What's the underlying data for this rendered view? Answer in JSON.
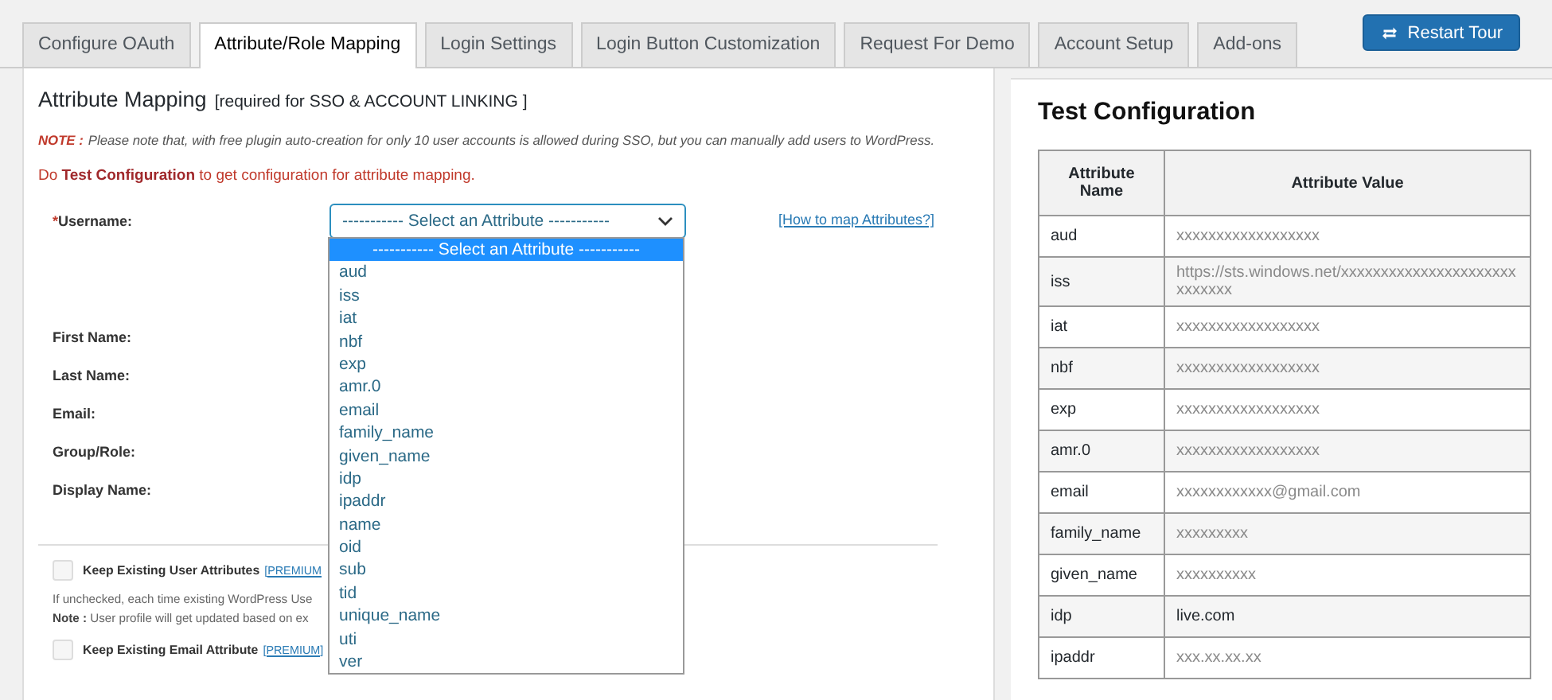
{
  "tabs": [
    {
      "label": "Configure OAuth",
      "selected": false
    },
    {
      "label": "Attribute/Role Mapping",
      "selected": true
    },
    {
      "label": "Login Settings",
      "selected": false
    },
    {
      "label": "Login Button Customization",
      "selected": false
    },
    {
      "label": "Request For Demo",
      "selected": false
    },
    {
      "label": "Account Setup",
      "selected": false
    },
    {
      "label": "Add-ons",
      "selected": false
    }
  ],
  "restart_button": {
    "label": "Restart Tour"
  },
  "attribute_mapping": {
    "title": "Attribute Mapping",
    "subtitle": "[required for SSO & ACCOUNT LINKING ]",
    "note_label": "NOTE :",
    "note_text": "Please note that, with free plugin auto-creation for only 10 user accounts is allowed during SSO, but you can manually add users to WordPress.",
    "hint": "Do **Test Configuration** to get configuration for attribute mapping.",
    "fields": [
      {
        "label": "Username:",
        "required_mark": "*"
      },
      {
        "label": "First Name:"
      },
      {
        "label": "Last Name:"
      },
      {
        "label": "Email:"
      },
      {
        "label": "Group/Role:"
      },
      {
        "label": "Display Name:"
      }
    ],
    "select": {
      "value": "----------- Select an Attribute -----------",
      "expanded": true,
      "options": [
        {
          "label": "----------- Select an Attribute -----------",
          "selected": true
        },
        {
          "label": "aud",
          "selected": false
        },
        {
          "label": "iss",
          "selected": false
        },
        {
          "label": "iat",
          "selected": false
        },
        {
          "label": "nbf",
          "selected": false
        },
        {
          "label": "exp",
          "selected": false
        },
        {
          "label": "amr.0",
          "selected": false
        },
        {
          "label": "email",
          "selected": false
        },
        {
          "label": "family_name",
          "selected": false
        },
        {
          "label": "given_name",
          "selected": false
        },
        {
          "label": "idp",
          "selected": false
        },
        {
          "label": "ipaddr",
          "selected": false
        },
        {
          "label": "name",
          "selected": false
        },
        {
          "label": "oid",
          "selected": false
        },
        {
          "label": "sub",
          "selected": false
        },
        {
          "label": "tid",
          "selected": false
        },
        {
          "label": "unique_name",
          "selected": false
        },
        {
          "label": "uti",
          "selected": false
        },
        {
          "label": "ver",
          "selected": false
        }
      ]
    },
    "help_link": "[How to map Attributes?]",
    "options": [
      {
        "kind": "checkbox",
        "label": "Keep Existing User Attributes",
        "badge": "[PREMIUM",
        "checked": false
      },
      {
        "kind": "text",
        "text": "If unchecked, each time existing WordPress Use"
      },
      {
        "kind": "text",
        "text": "**Note :** User profile will get updated based on ex"
      },
      {
        "kind": "checkbox",
        "label": "Keep Existing Email Attribute",
        "badge": "[PREMIUM]",
        "checked": false
      }
    ]
  },
  "test_configuration": {
    "title": "Test Configuration",
    "columns": [
      "Attribute Name",
      "Attribute Value"
    ],
    "rows": [
      {
        "name": "aud",
        "value": "xxxxxxxxxxxxxxxxxx",
        "masked": true
      },
      {
        "name": "iss",
        "value": "https://sts.windows.net/xxxxxxxxxxxxxxxxxxxxxxxxxxxxx",
        "masked": true
      },
      {
        "name": "iat",
        "value": "xxxxxxxxxxxxxxxxxx",
        "masked": true
      },
      {
        "name": "nbf",
        "value": "xxxxxxxxxxxxxxxxxx",
        "masked": true
      },
      {
        "name": "exp",
        "value": "xxxxxxxxxxxxxxxxxx",
        "masked": true
      },
      {
        "name": "amr.0",
        "value": "xxxxxxxxxxxxxxxxxx",
        "masked": true
      },
      {
        "name": "email",
        "value": "xxxxxxxxxxxx@gmail.com",
        "masked": true
      },
      {
        "name": "family_name",
        "value": "xxxxxxxxx",
        "masked": true
      },
      {
        "name": "given_name",
        "value": "xxxxxxxxxx",
        "masked": true
      },
      {
        "name": "idp",
        "value": "live.com",
        "masked": false
      },
      {
        "name": "ipaddr",
        "value": "xxx.xx.xx.xx",
        "masked": true
      }
    ]
  }
}
